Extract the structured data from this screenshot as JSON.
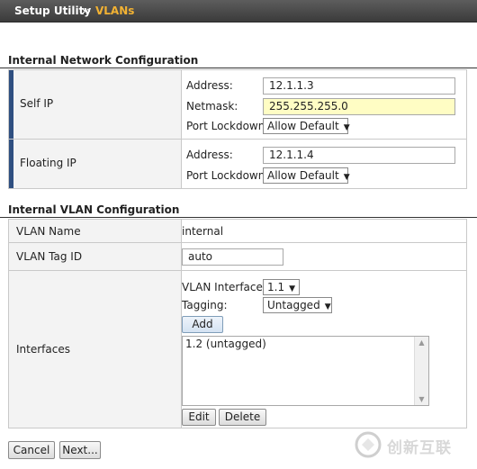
{
  "breadcrumb": {
    "root": "Setup Utility",
    "separator": "››",
    "current": "VLANs"
  },
  "internal_network": {
    "title": "Internal Network Configuration",
    "self_ip": {
      "label": "Self IP",
      "address_label": "Address:",
      "address_value": "12.1.1.3",
      "netmask_label": "Netmask:",
      "netmask_value": "255.255.255.0",
      "port_lockdown_label": "Port Lockdown:",
      "port_lockdown_value": "Allow Default"
    },
    "floating_ip": {
      "label": "Floating IP",
      "address_label": "Address:",
      "address_value": "12.1.1.4",
      "port_lockdown_label": "Port Lockdown:",
      "port_lockdown_value": "Allow Default"
    }
  },
  "internal_vlan": {
    "title": "Internal VLAN Configuration",
    "vlan_name_label": "VLAN Name",
    "vlan_name_value": "internal",
    "vlan_tag_label": "VLAN Tag ID",
    "vlan_tag_value": "auto",
    "interfaces_label": "Interfaces",
    "vlan_interfaces_label": "VLAN Interfaces",
    "vlan_interfaces_value": "1.1",
    "tagging_label": "Tagging:",
    "tagging_value": "Untagged",
    "add_button": "Add",
    "interface_list": [
      "1.2 (untagged)"
    ],
    "edit_button": "Edit",
    "delete_button": "Delete"
  },
  "footer": {
    "cancel_button": "Cancel",
    "next_button": "Next..."
  },
  "watermark": {
    "text": "创新互联"
  },
  "colors": {
    "accent_bar": "#2f4f80",
    "breadcrumb_current": "#f2b233",
    "netmask_highlight": "#fffdc4"
  }
}
